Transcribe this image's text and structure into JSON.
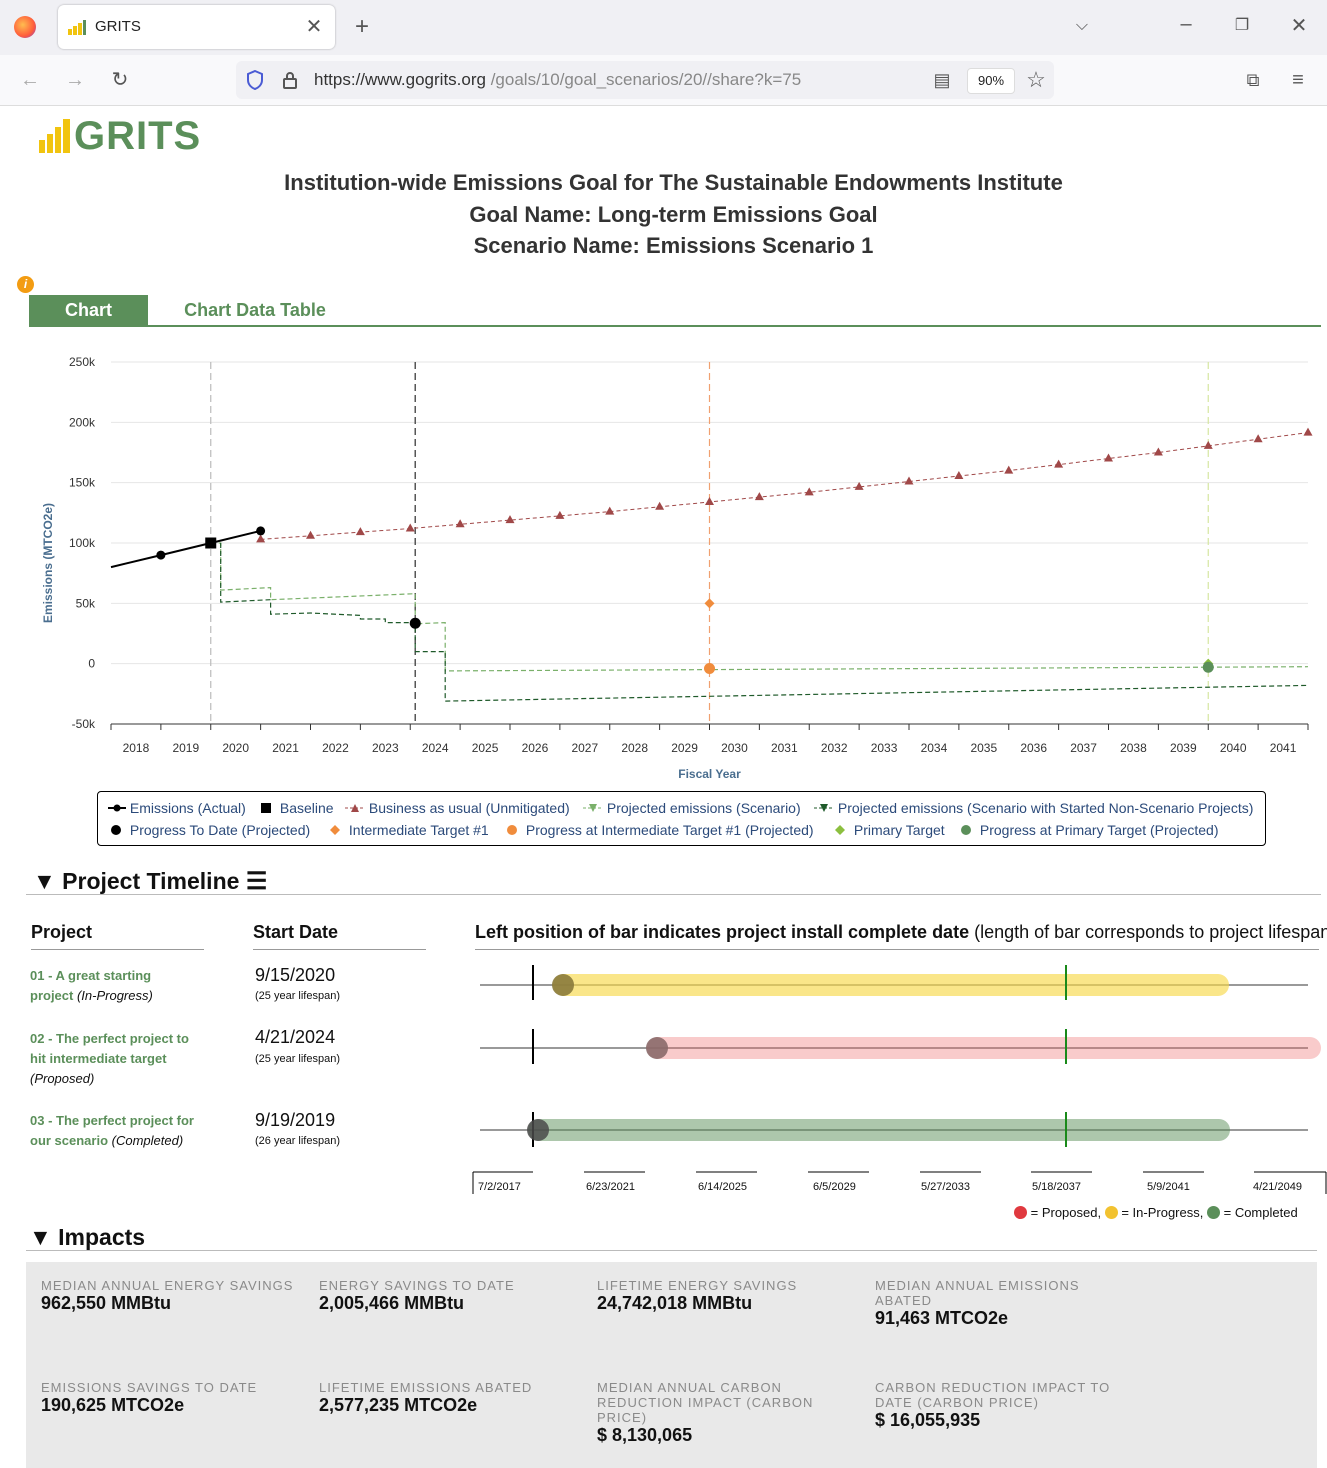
{
  "browser": {
    "tab_title": "GRITS",
    "url_domain": "https://www.gogrits.org",
    "url_path": "/goals/10/goal_scenarios/20//share?k=75",
    "zoom": "90%"
  },
  "header": {
    "logo": "GRITS",
    "title_line1": "Institution-wide Emissions Goal for The Sustainable Endowments Institute",
    "title_line2": "Goal Name: Long-term Emissions Goal",
    "title_line3": "Scenario Name: Emissions Scenario 1"
  },
  "tabs": {
    "chart": "Chart",
    "table": "Chart Data Table"
  },
  "chart_data": {
    "type": "line",
    "ylabel": "Emissions (MTCO2e)",
    "xlabel": "Fiscal Year",
    "ylim": [
      -50000,
      250000
    ],
    "y_ticks": [
      "250k",
      "200k",
      "150k",
      "100k",
      "50k",
      "0",
      "-50k"
    ],
    "x_ticks": [
      "2018",
      "2019",
      "2020",
      "2021",
      "2022",
      "2023",
      "2024",
      "2025",
      "2026",
      "2027",
      "2028",
      "2029",
      "2030",
      "2031",
      "2032",
      "2033",
      "2034",
      "2035",
      "2036",
      "2037",
      "2038",
      "2039",
      "2040",
      "2041"
    ],
    "series": [
      {
        "name": "Emissions (Actual)",
        "color": "#000000",
        "points": [
          [
            2017.5,
            80000
          ],
          [
            2018.5,
            90000
          ],
          [
            2019.5,
            100000
          ],
          [
            2020.5,
            110000
          ]
        ]
      },
      {
        "name": "Baseline",
        "color": "#000000",
        "points": [
          [
            2019.5,
            100000
          ]
        ]
      },
      {
        "name": "Business as usual (Unmitigated)",
        "color": "#a04848",
        "points": [
          [
            2020.5,
            103000
          ],
          [
            2021.5,
            106000
          ],
          [
            2022.5,
            109000
          ],
          [
            2023.5,
            112000
          ],
          [
            2024.5,
            115500
          ],
          [
            2025.5,
            119000
          ],
          [
            2026.5,
            122500
          ],
          [
            2027.5,
            126000
          ],
          [
            2028.5,
            130000
          ],
          [
            2029.5,
            134000
          ],
          [
            2030.5,
            138000
          ],
          [
            2031.5,
            142000
          ],
          [
            2032.5,
            146500
          ],
          [
            2033.5,
            151000
          ],
          [
            2034.5,
            155500
          ],
          [
            2035.5,
            160000
          ],
          [
            2036.5,
            165000
          ],
          [
            2037.5,
            170000
          ],
          [
            2038.5,
            175000
          ],
          [
            2039.5,
            180500
          ],
          [
            2040.5,
            186000
          ],
          [
            2041.5,
            191500
          ]
        ]
      },
      {
        "name": "Projected emissions (Scenario)",
        "color": "#7ab06a",
        "points": [
          [
            2019.5,
            100000
          ],
          [
            2019.7,
            100000
          ],
          [
            2019.7,
            61000
          ],
          [
            2020.7,
            63000
          ],
          [
            2020.7,
            53000
          ],
          [
            2023.6,
            58000
          ],
          [
            2023.6,
            33000
          ],
          [
            2024.2,
            34000
          ],
          [
            2024.2,
            -6000
          ],
          [
            2041.5,
            -2500
          ]
        ]
      },
      {
        "name": "Projected emissions (Scenario with Started Non-Scenario Projects)",
        "color": "#1f5a2a",
        "points": [
          [
            2019.7,
            100000
          ],
          [
            2019.7,
            51000
          ],
          [
            2020.7,
            53000
          ],
          [
            2020.7,
            41000
          ],
          [
            2021.5,
            42000
          ],
          [
            2022.5,
            40000
          ],
          [
            2022.5,
            37000
          ],
          [
            2023.0,
            37000
          ],
          [
            2023.0,
            34000
          ],
          [
            2023.6,
            34000
          ],
          [
            2023.6,
            10000
          ],
          [
            2024.2,
            10000
          ],
          [
            2024.2,
            -31000
          ],
          [
            2041.5,
            -18000
          ]
        ]
      },
      {
        "name": "Progress To Date (Projected)",
        "color": "#000000",
        "points": [
          [
            2023.6,
            33500
          ]
        ]
      },
      {
        "name": "Intermediate Target #1",
        "color": "#f08c3c",
        "points": [
          [
            2029.5,
            50000
          ]
        ]
      },
      {
        "name": "Progress at Intermediate Target #1 (Projected)",
        "color": "#f08c3c",
        "points": [
          [
            2029.5,
            -4000
          ]
        ]
      },
      {
        "name": "Primary Target",
        "color": "#8cbf3f",
        "points": [
          [
            2039.5,
            0
          ]
        ]
      },
      {
        "name": "Progress at Primary Target (Projected)",
        "color": "#5b8f5a",
        "points": [
          [
            2039.5,
            -3000
          ]
        ]
      }
    ],
    "vlines": [
      {
        "x": 2019.5,
        "color": "#bbbbbb"
      },
      {
        "x": 2023.6,
        "color": "#555555"
      },
      {
        "x": 2029.5,
        "color": "#f0a070"
      },
      {
        "x": 2039.5,
        "color": "#d6e6a0"
      }
    ],
    "grid": true,
    "legend_placement": "bottom"
  },
  "legend": [
    "Emissions (Actual)",
    "Baseline",
    "Business as usual (Unmitigated)",
    "Projected emissions (Scenario)",
    "Projected emissions (Scenario with Started Non-Scenario Projects)",
    "Progress To Date (Projected)",
    "Intermediate Target #1",
    "Progress at Intermediate Target #1 (Projected)",
    "Primary Target",
    "Progress at Primary Target (Projected)"
  ],
  "timeline": {
    "heading": "Project Timeline",
    "col_project": "Project",
    "col_start": "Start Date",
    "col_bar_bold": "Left position of bar indicates project install complete date",
    "col_bar_normal": "(length of bar corresponds to project lifespan)",
    "projects": [
      {
        "name_a": "01 - A great starting",
        "name_b": "project",
        "status": "(In-Progress)",
        "date": "9/15/2020",
        "life": "(25 year lifespan)",
        "color": "#f7d94a"
      },
      {
        "name_a": "02 - The perfect project to",
        "name_b": "hit intermediate target",
        "status": "(Proposed)",
        "date": "4/21/2024",
        "life": "(25 year lifespan)",
        "color": "#ee6b6b"
      },
      {
        "name_a": "03 - The perfect project for",
        "name_b": "our scenario",
        "status": "(Completed)",
        "date": "9/19/2019",
        "life": "(26 year lifespan)",
        "color": "#5b8f5a"
      }
    ],
    "axis_ticks": [
      "7/2/2017",
      "6/23/2021",
      "6/14/2025",
      "6/5/2029",
      "5/27/2033",
      "5/18/2037",
      "5/9/2041",
      "4/21/2049"
    ],
    "key_proposed": "= Proposed,",
    "key_inprogress": "= In-Progress,",
    "key_completed": "= Completed"
  },
  "impacts": {
    "heading": "Impacts",
    "items": [
      {
        "label": "MEDIAN ANNUAL ENERGY SAVINGS",
        "value": "962,550 MMBtu"
      },
      {
        "label": "ENERGY SAVINGS TO DATE",
        "value": "2,005,466 MMBtu"
      },
      {
        "label": "LIFETIME ENERGY SAVINGS",
        "value": "24,742,018 MMBtu"
      },
      {
        "label": "MEDIAN ANNUAL EMISSIONS ABATED",
        "value": "91,463 MTCO2e"
      },
      {
        "label": "EMISSIONS SAVINGS TO DATE",
        "value": "190,625 MTCO2e"
      },
      {
        "label": "LIFETIME EMISSIONS ABATED",
        "value": "2,577,235 MTCO2e"
      },
      {
        "label": "MEDIAN ANNUAL CARBON REDUCTION IMPACT (CARBON PRICE)",
        "value": "$ 8,130,065"
      },
      {
        "label": "CARBON REDUCTION IMPACT TO DATE (CARBON PRICE)",
        "value": "$ 16,055,935"
      }
    ]
  }
}
